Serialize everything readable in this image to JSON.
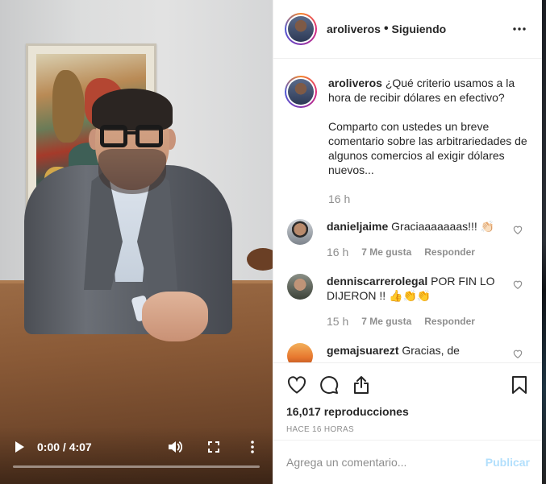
{
  "video": {
    "time": "0:00 / 4:07",
    "progress": 0
  },
  "header": {
    "username": "aroliveros",
    "separator": "•",
    "follow_status": "Siguiendo"
  },
  "caption": {
    "username": "aroliveros",
    "paragraph1": "¿Qué criterio usamos a la hora de recibir dólares en efectivo?",
    "paragraph2": "Comparto con ustedes un breve comentario sobre las arbitrariedades de algunos comercios al exigir dólares nuevos...",
    "time": "16 h"
  },
  "comments": [
    {
      "username": "danieljaime",
      "text": "Graciaaaaaaas!!! 👏🏻",
      "time": "16 h",
      "likes": "7 Me gusta",
      "reply": "Responder"
    },
    {
      "username": "denniscarrerolegal",
      "text": "POR FIN LO DIJERON !! 👍👏👏",
      "time": "15 h",
      "likes": "7 Me gusta",
      "reply": "Responder"
    },
    {
      "username": "gemajsuarezt",
      "text": "Gracias, de"
    }
  ],
  "stats": {
    "views": "16,017 reproducciones",
    "ago": "HACE 16 HORAS"
  },
  "add_comment": {
    "placeholder": "Agrega un comentario...",
    "publish": "Publicar"
  },
  "colors": {
    "publish_disabled": "#b2dffc",
    "secondary_text": "#8e8e8e",
    "primary_text": "#262626"
  }
}
